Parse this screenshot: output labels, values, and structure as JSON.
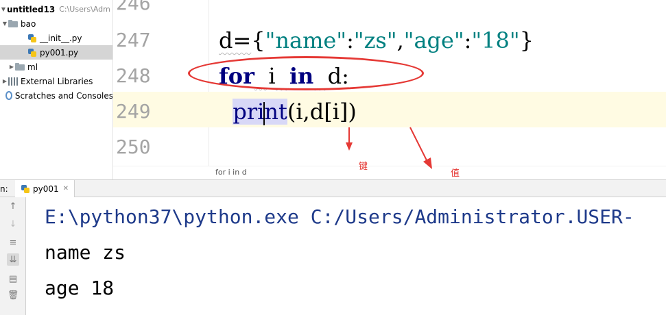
{
  "project": {
    "root_name": "untitled13",
    "root_path": "C:\\Users\\Adm",
    "items": [
      {
        "label": "bao",
        "type": "folder"
      },
      {
        "label": "__init__.py",
        "type": "file"
      },
      {
        "label": "py001.py",
        "type": "file",
        "selected": true
      },
      {
        "label": "ml",
        "type": "folder"
      },
      {
        "label": "External Libraries",
        "type": "library"
      },
      {
        "label": "Scratches and Consoles",
        "type": "scratch"
      }
    ]
  },
  "editor": {
    "line_numbers": [
      "246",
      "247",
      "248",
      "249",
      "250"
    ],
    "line247": {
      "var": "d=",
      "open": "{",
      "k1": "\"name\"",
      "colon1": ":",
      "v1": "\"zs\"",
      "comma": ",",
      "k2": "\"age\"",
      "colon2": ":",
      "v2": "\"18\"",
      "close": "}"
    },
    "line248": {
      "kw_for": "for",
      "var_i": "i",
      "kw_in": "in",
      "var_d": "d:"
    },
    "line249": {
      "fn_a": "pri",
      "fn_b": "nt",
      "args": "(i,d[i])"
    },
    "breadcrumb": "for i in d"
  },
  "annotations": {
    "key_label": "键",
    "value_label": "值",
    "color": "#e53935"
  },
  "run": {
    "panel_label": "n:",
    "tab_label": "py001",
    "output": [
      "E:\\python37\\python.exe C:/Users/Administrator.USER-",
      "name zs",
      "age 18"
    ]
  },
  "colors": {
    "keyword": "#000080",
    "string": "#008080",
    "caret_line": "#fffbe3"
  }
}
